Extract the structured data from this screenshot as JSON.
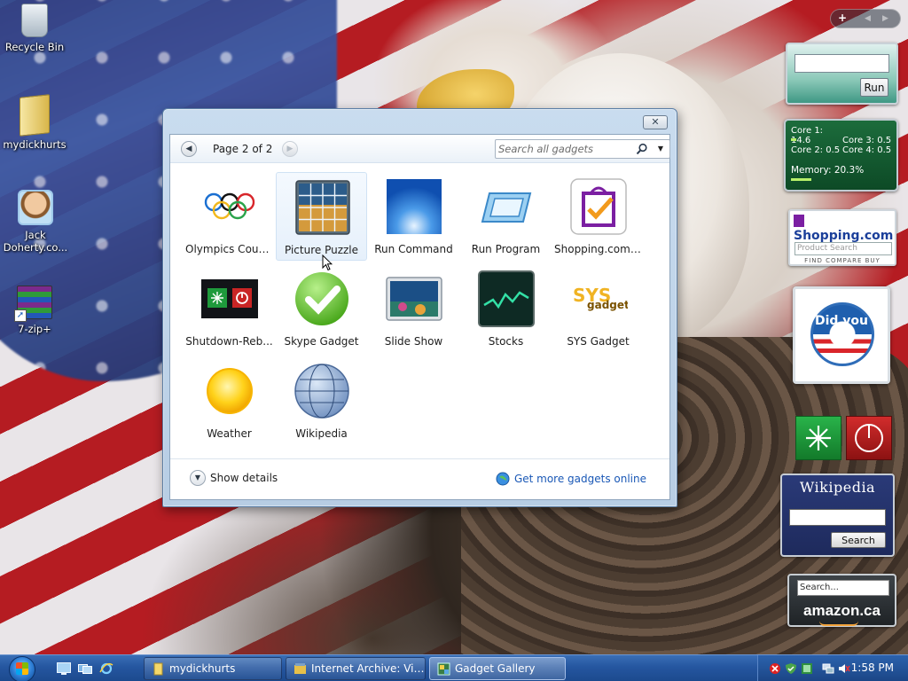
{
  "desktop": {
    "icons": [
      {
        "label": "Recycle Bin",
        "icon": "recycle-bin-icon"
      },
      {
        "label": "mydickhurts",
        "icon": "folder-icon"
      },
      {
        "label": "Jack Doherty.co...",
        "icon": "user-picture-icon"
      },
      {
        "label": "7-zip+",
        "icon": "winrar-archive-icon"
      }
    ]
  },
  "gallery": {
    "page_label": "Page 2 of 2",
    "search_placeholder": "Search all gadgets",
    "gadgets": [
      {
        "label": "Olympics Coun...",
        "icon": "olympic-rings-icon"
      },
      {
        "label": "Picture Puzzle",
        "icon": "picture-puzzle-icon",
        "selected": true
      },
      {
        "label": "Run Command",
        "icon": "run-command-icon"
      },
      {
        "label": "Run Program",
        "icon": "run-program-icon"
      },
      {
        "label": "Shopping.com ...",
        "icon": "shopping-bag-icon"
      },
      {
        "label": "Shutdown-Reb...",
        "icon": "shutdown-reboot-icon"
      },
      {
        "label": "Skype Gadget",
        "icon": "skype-check-icon"
      },
      {
        "label": "Slide Show",
        "icon": "slide-show-icon"
      },
      {
        "label": "Stocks",
        "icon": "stocks-icon"
      },
      {
        "label": "SYS Gadget",
        "icon": "sys-gadget-icon"
      },
      {
        "label": "Weather",
        "icon": "weather-sun-icon"
      },
      {
        "label": "Wikipedia",
        "icon": "wikipedia-globe-icon"
      }
    ],
    "show_details_label": "Show details",
    "get_more_label": "Get more gadgets online"
  },
  "sidebar": {
    "run_button_label": "Run",
    "cpu": {
      "core1": "Core 1: 14.6",
      "core2": "Core 2: 0.5",
      "core3": "Core 3: 0.5",
      "core4": "Core 4: 0.5",
      "memory": "Memory: 20.3%",
      "memory_percent": 20.3
    },
    "shopping": {
      "brand": "Shopping.com",
      "search_placeholder": "Product Search",
      "tagline": "FIND COMPARE BUY"
    },
    "obama_text": "Did you",
    "wikipedia": {
      "title": "Wikipedia",
      "search_button": "Search"
    },
    "amazon": {
      "search_value": "Search...",
      "brand": "amazon.ca"
    }
  },
  "taskbar": {
    "tasks": [
      {
        "label": "mydickhurts",
        "icon": "folder-icon"
      },
      {
        "label": "Internet Archive: Vie...",
        "icon": "internet-archive-icon"
      },
      {
        "label": "Gadget Gallery",
        "icon": "gadget-gallery-icon",
        "active": true
      }
    ],
    "clock": "1:58 PM"
  },
  "colors": {
    "taskbar": "#2556a0",
    "link": "#1a58b6",
    "selection": "#e6f0fb"
  }
}
